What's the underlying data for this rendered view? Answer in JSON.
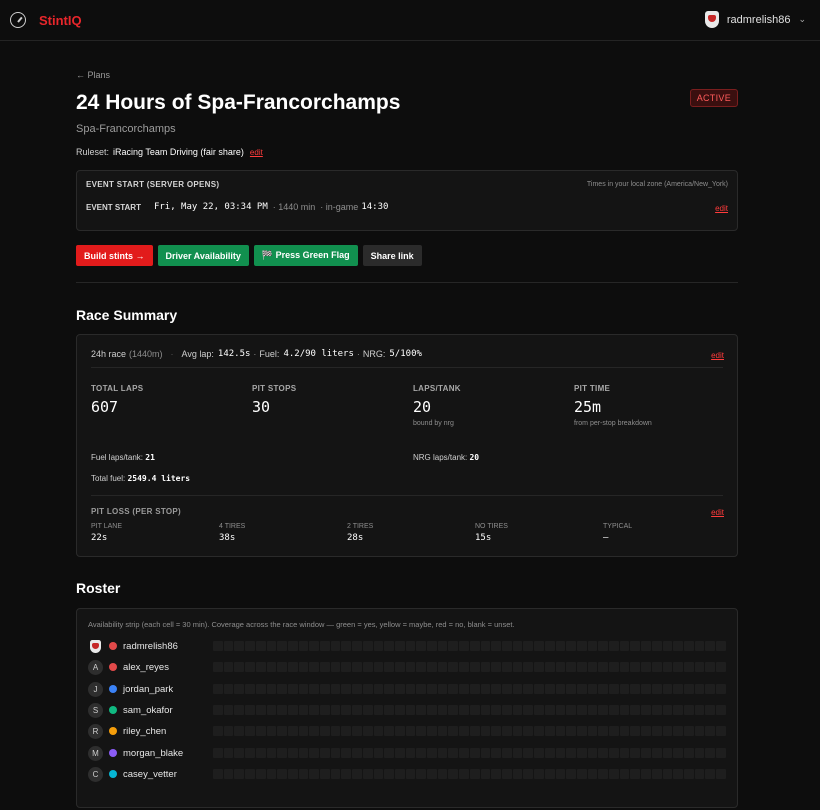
{
  "app": {
    "brand": "StintIQ",
    "logo_icon": "stopwatch-icon"
  },
  "user": {
    "name": "radmrelish86",
    "avatar_icon": "team-shield-icon",
    "menu_chevron": "⌄"
  },
  "nav": {
    "back_label": "← Plans"
  },
  "event": {
    "title": "24 Hours of Spa-Francorchamps",
    "status": "ACTIVE",
    "track": "Spa-Francorchamps",
    "ruleset_label": "Ruleset:",
    "ruleset_value": "iRacing Team Driving (fair share)",
    "edit_label": "edit"
  },
  "event_start": {
    "heading": "EVENT START (SERVER OPENS)",
    "tz_note": "Times in your local zone (America/New_York)",
    "row_label": "EVENT START",
    "datetime": "Fri, May 22, 03:34 PM",
    "duration": "· 1440 min",
    "ingame_label": "· in-game",
    "ingame_time": "14:30",
    "edit_label": "edit"
  },
  "actions": {
    "build": "Build stints →",
    "availability": "Driver Availability",
    "green_flag": "🏁 Press Green Flag",
    "share": "Share link"
  },
  "race_summary": {
    "heading": "Race Summary",
    "race_type": "24h race",
    "race_minutes": "(1440m)",
    "avg_lap_label": "Avg lap:",
    "avg_lap": "142.5s",
    "fuel_label": "Fuel:",
    "fuel": "4.2/90 liters",
    "nrg_label": "NRG:",
    "nrg": "5/100%",
    "edit_label": "edit",
    "stats": {
      "total_laps_label": "TOTAL LAPS",
      "total_laps": "607",
      "pit_stops_label": "PIT STOPS",
      "pit_stops": "30",
      "laps_tank_label": "LAPS/TANK",
      "laps_tank": "20",
      "laps_tank_note": "bound by nrg",
      "pit_time_label": "PIT TIME",
      "pit_time": "25m",
      "pit_time_note": "from per-stop breakdown"
    },
    "fuel_laps_label": "Fuel laps/tank:",
    "fuel_laps": "21",
    "nrg_laps_label": "NRG laps/tank:",
    "nrg_laps": "20",
    "total_fuel_label": "Total fuel:",
    "total_fuel": "2549.4 liters",
    "pit_loss": {
      "heading": "PIT LOSS (PER STOP)",
      "edit_label": "edit",
      "items": [
        {
          "label": "PIT LANE",
          "value": "22s"
        },
        {
          "label": "4 TIRES",
          "value": "38s"
        },
        {
          "label": "2 TIRES",
          "value": "28s"
        },
        {
          "label": "NO TIRES",
          "value": "15s"
        },
        {
          "label": "TYPICAL",
          "value": "—"
        }
      ]
    }
  },
  "roster": {
    "heading": "Roster",
    "note": "Availability strip (each cell = 30 min). Coverage across the race window — green = yes, yellow = maybe, red = no, blank = unset.",
    "drivers": [
      {
        "initial": "",
        "name": "radmrelish86",
        "color": "#e24a4a"
      },
      {
        "initial": "A",
        "name": "alex_reyes",
        "color": "#e24a4a"
      },
      {
        "initial": "J",
        "name": "jordan_park",
        "color": "#3b82f6"
      },
      {
        "initial": "S",
        "name": "sam_okafor",
        "color": "#10b981"
      },
      {
        "initial": "R",
        "name": "riley_chen",
        "color": "#f59e0b"
      },
      {
        "initial": "M",
        "name": "morgan_blake",
        "color": "#8b5cf6"
      },
      {
        "initial": "C",
        "name": "casey_vetter",
        "color": "#06b6d4"
      }
    ]
  }
}
